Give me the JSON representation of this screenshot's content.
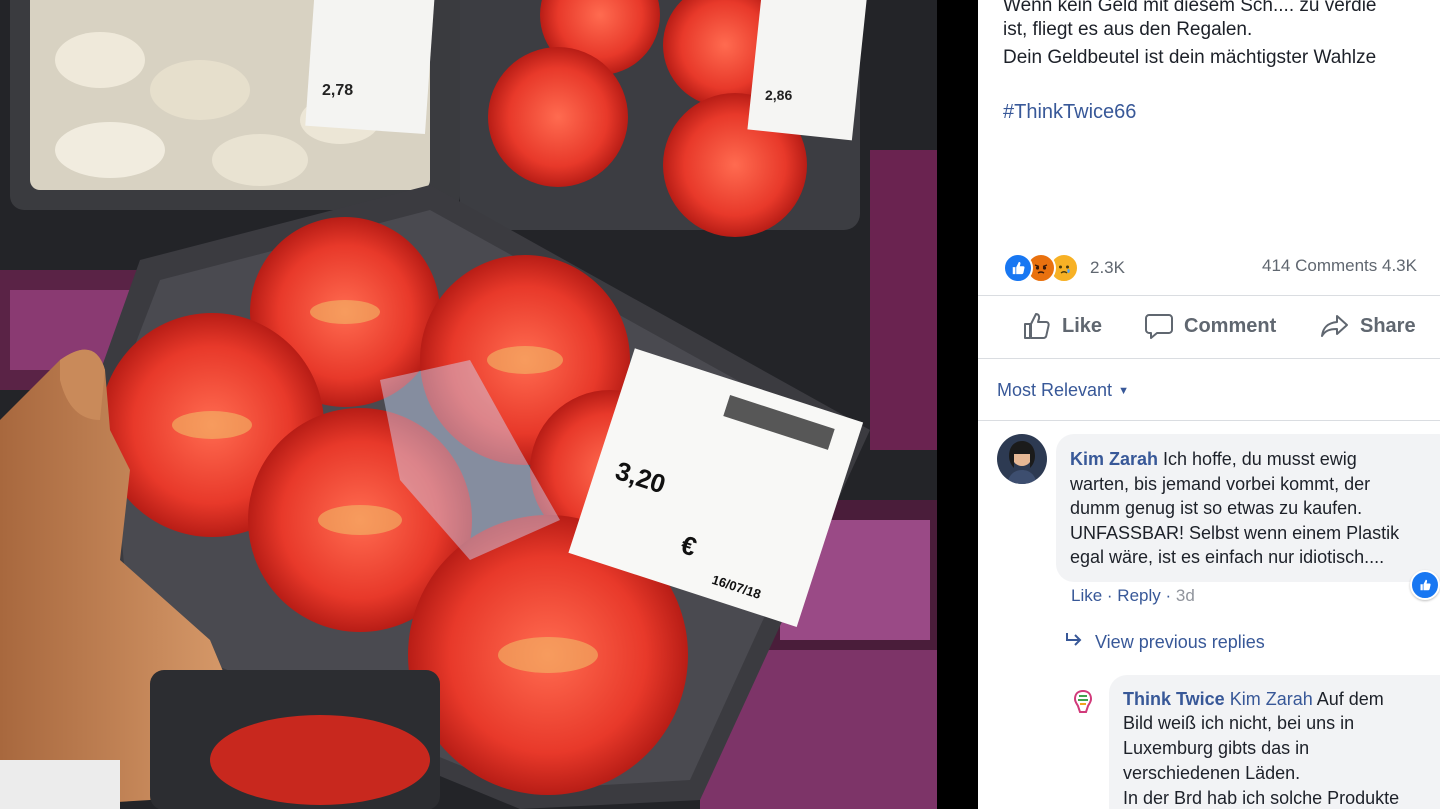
{
  "post": {
    "text_lines": [
      "Wenn kein Geld mit diesem Sch.... zu verdie",
      "ist, fliegt es aus den Regalen.",
      "Dein Geldbeutel ist dein mächtigster Wahlze"
    ],
    "hashtag": "#ThinkTwice66"
  },
  "stats": {
    "reactions": [
      "like-icon",
      "angry-icon",
      "sad-icon"
    ],
    "reaction_count": "2.3K",
    "comments_shares": "414 Comments  4.3K"
  },
  "actions": {
    "like": "Like",
    "comment": "Comment",
    "share": "Share"
  },
  "sort": {
    "label": "Most Relevant"
  },
  "comments": [
    {
      "author": "Kim Zarah",
      "first_line_rest": " Ich hoffe, du musst ewig",
      "lines": [
        "warten, bis jemand vorbei kommt, der",
        "dumm genug ist so etwas zu kaufen.",
        "UNFASSBAR! Selbst wenn einem Plastik",
        "egal wäre, ist es einfach nur idiotisch...."
      ],
      "like": "Like",
      "sep1": " · ",
      "reply": "Reply",
      "sep2": " · ",
      "time": "3d"
    }
  ],
  "view_previous": "View previous replies",
  "reply": {
    "author": "Think Twice",
    "tag": "Kim Zarah",
    "first_line_rest": " Auf dem",
    "lines": [
      "Bild weiß ich nicht, bei uns in",
      "Luxemburg gibts das in",
      "verschiedenen Läden.",
      "In der Brd hab ich solche Produkte"
    ]
  },
  "photo": {
    "price_main": "3,20",
    "price_main_currency": "€",
    "date_main": "16/07/18",
    "price_top_left": "2,78",
    "price_top_right": "2,86",
    "currency": "€"
  },
  "colors": {
    "link": "#385898",
    "like_blue": "#1877f2",
    "tomato": "#e2382a"
  }
}
